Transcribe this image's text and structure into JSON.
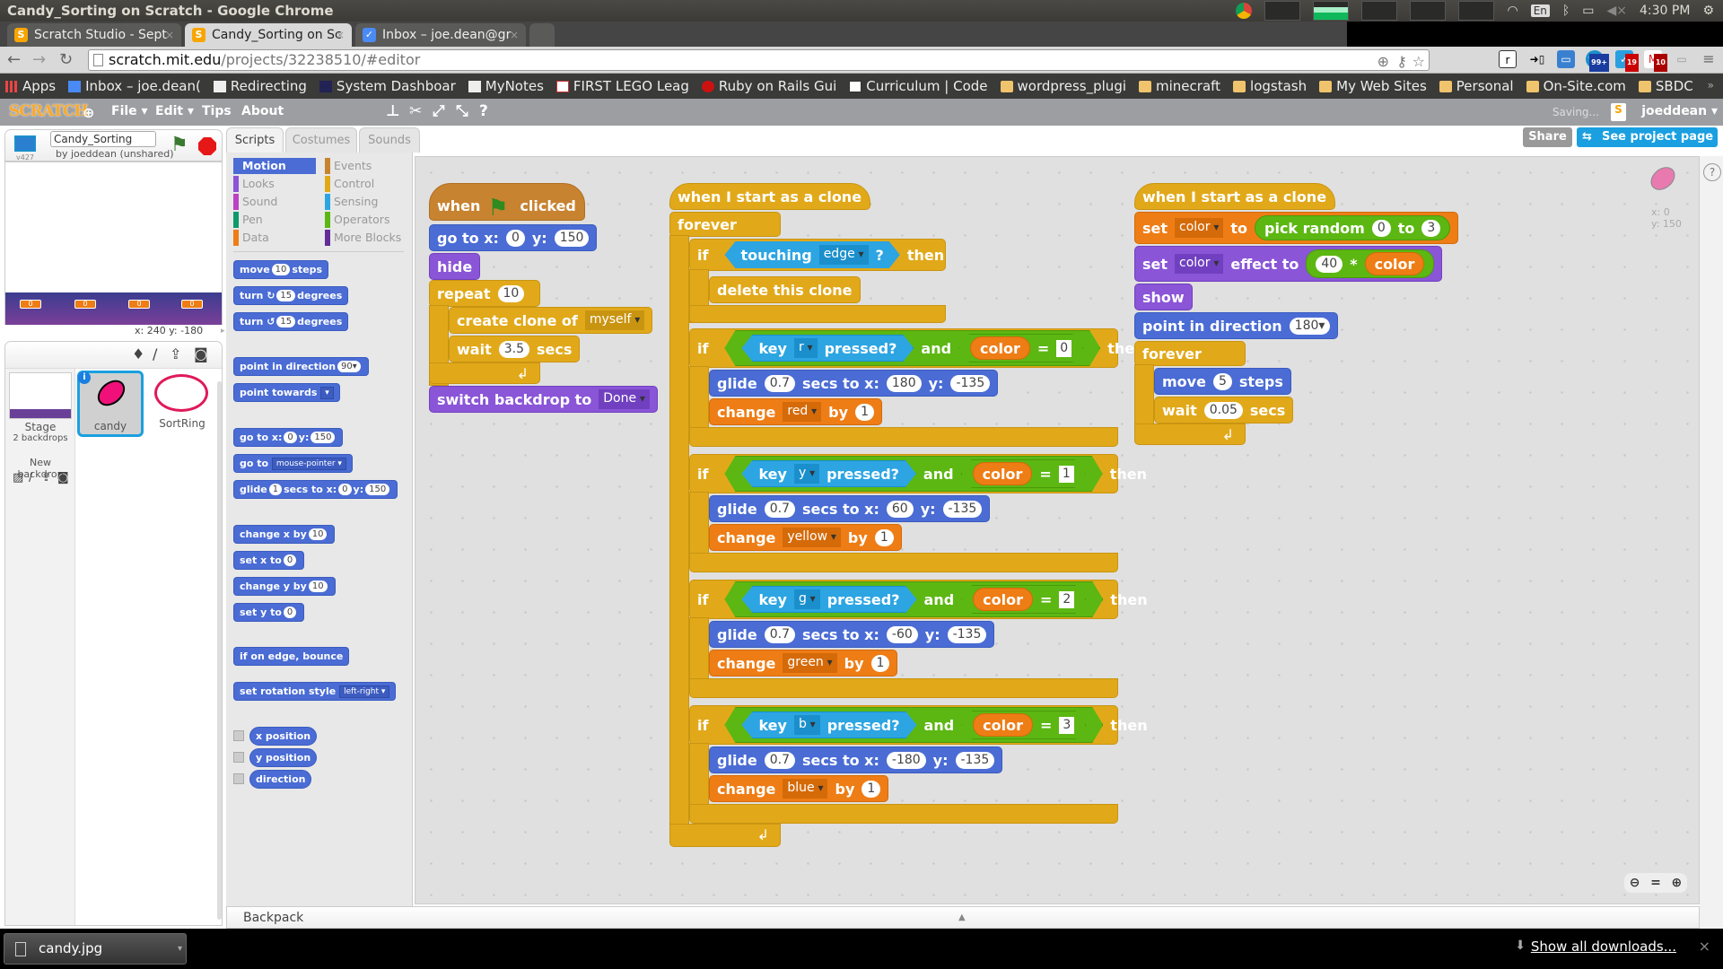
{
  "os": {
    "window_title": "Candy_Sorting on Scratch - Google Chrome",
    "tray": {
      "lang": "En",
      "time": "4:30 PM"
    }
  },
  "browser": {
    "tabs": [
      {
        "label": "Scratch Studio - Sept",
        "active": false
      },
      {
        "label": "Candy_Sorting on Sc",
        "active": true
      },
      {
        "label": "Inbox – joe.dean@gr",
        "active": false
      }
    ],
    "url_host": "scratch.mit.edu",
    "url_path": "/projects/32238510/#editor",
    "extensions": [
      {
        "name": "r-icon"
      },
      {
        "name": "phone-icon"
      },
      {
        "name": "window-icon"
      },
      {
        "name": "skype-icon",
        "badge": "99+"
      },
      {
        "name": "tasks-icon",
        "badge": "19"
      },
      {
        "name": "gmail-icon",
        "badge": "10"
      }
    ],
    "bookmarks": [
      {
        "label": "Apps",
        "type": "apps"
      },
      {
        "label": "Inbox – joe.dean(",
        "type": "mail"
      },
      {
        "label": "Redirecting",
        "type": "page"
      },
      {
        "label": "System Dashboar",
        "type": "page"
      },
      {
        "label": "MyNotes",
        "type": "page"
      },
      {
        "label": "FIRST LEGO Leag",
        "type": "page"
      },
      {
        "label": "Ruby on Rails Gui",
        "type": "page"
      },
      {
        "label": "Curriculum | Code",
        "type": "page"
      },
      {
        "label": "wordpress_plugi",
        "type": "folder"
      },
      {
        "label": "minecraft",
        "type": "folder"
      },
      {
        "label": "logstash",
        "type": "folder"
      },
      {
        "label": "My Web Sites",
        "type": "folder"
      },
      {
        "label": "Personal",
        "type": "folder"
      },
      {
        "label": "On-Site.com",
        "type": "folder"
      },
      {
        "label": "SBDC",
        "type": "folder"
      }
    ],
    "downloads": {
      "file": "candy.jpg",
      "show_all": "Show all downloads..."
    }
  },
  "scratch": {
    "logo": "SCRATCH",
    "menu": [
      "File ▾",
      "Edit ▾",
      "Tips",
      "About"
    ],
    "saving": "Saving...",
    "user": "joeddean ▾",
    "share": "Share",
    "see_project": "See project page",
    "project_title": "Candy_Sorting",
    "author": "by joeddean (unshared)",
    "version": "v427",
    "stage_coords": "x: 240  y: -180",
    "monitors": [
      "0",
      "0",
      "0",
      "0"
    ],
    "sprites": [
      {
        "name": "candy",
        "selected": true
      },
      {
        "name": "SortRing",
        "selected": false
      }
    ],
    "stage": {
      "label": "Stage",
      "backdrops": "2 backdrops",
      "new_backdrop": "New backdrop"
    },
    "editor_tabs": [
      "Scripts",
      "Costumes",
      "Sounds"
    ],
    "categories": [
      {
        "label": "Motion",
        "color": "#4a6cd4",
        "selected": true
      },
      {
        "label": "Events",
        "color": "#c88330"
      },
      {
        "label": "Looks",
        "color": "#8a55d7"
      },
      {
        "label": "Control",
        "color": "#e1a91a"
      },
      {
        "label": "Sound",
        "color": "#bb42c3"
      },
      {
        "label": "Sensing",
        "color": "#2ca5e2"
      },
      {
        "label": "Pen",
        "color": "#0e9a6c"
      },
      {
        "label": "Operators",
        "color": "#5cb712"
      },
      {
        "label": "Data",
        "color": "#ee7d16"
      },
      {
        "label": "More Blocks",
        "color": "#632d99"
      }
    ],
    "palette": {
      "move": [
        "move",
        "10",
        "steps"
      ],
      "turn_cw": [
        "turn",
        "15",
        "degrees"
      ],
      "turn_ccw": [
        "turn",
        "15",
        "degrees"
      ],
      "point_dir": [
        "point in direction",
        "90▾"
      ],
      "point_towards": [
        "point towards"
      ],
      "goto_xy": [
        "go to x:",
        "0",
        "y:",
        "150"
      ],
      "goto": [
        "go to",
        "mouse-pointer ▾"
      ],
      "glide": [
        "glide",
        "1",
        "secs to x:",
        "0",
        "y:",
        "150"
      ],
      "change_x": [
        "change x by",
        "10"
      ],
      "set_x": [
        "set x to",
        "0"
      ],
      "change_y": [
        "change y by",
        "10"
      ],
      "set_y": [
        "set y to",
        "0"
      ],
      "bounce": "if on edge, bounce",
      "rotation": [
        "set rotation style",
        "left-right ▾"
      ],
      "reporters": [
        "x position",
        "y position",
        "direction"
      ]
    },
    "sprite_info": {
      "x": "x: 0",
      "y": "y: 150"
    },
    "backpack": "Backpack",
    "script1": {
      "hat": [
        "when",
        "clicked"
      ],
      "goto": [
        "go to x:",
        "0",
        "y:",
        "150"
      ],
      "hide": "hide",
      "repeat": [
        "repeat",
        "10"
      ],
      "clone": [
        "create clone of",
        "myself"
      ],
      "wait": [
        "wait",
        "3.5",
        "secs"
      ],
      "backdrop": [
        "switch backdrop to",
        "Done"
      ]
    },
    "script2": {
      "hat": "when I start as a clone",
      "forever": "forever",
      "if_edge": [
        "if",
        "touching",
        "edge",
        "?",
        "then"
      ],
      "delete": "delete this clone",
      "ifs": [
        {
          "key": "r",
          "value": "0",
          "x": "180",
          "y": "-135",
          "var": "red"
        },
        {
          "key": "y",
          "value": "1",
          "x": "60",
          "y": "-135",
          "var": "yellow"
        },
        {
          "key": "g",
          "value": "2",
          "x": "-60",
          "y": "-135",
          "var": "green"
        },
        {
          "key": "b",
          "value": "3",
          "x": "-180",
          "y": "-135",
          "var": "blue"
        }
      ],
      "words": {
        "if": "if",
        "key": "key",
        "pressed": "pressed?",
        "and": "and",
        "color": "color",
        "eq": "=",
        "then": "then",
        "glide": "glide",
        "secs_to_x": "secs to x:",
        "y": "y:",
        "secs": "0.7",
        "change": "change",
        "by": "by",
        "one": "1"
      }
    },
    "script3": {
      "hat": "when I start as a clone",
      "set_var": [
        "set",
        "color",
        "to",
        "pick random",
        "0",
        "to",
        "3"
      ],
      "set_effect": [
        "set",
        "color",
        "effect to",
        "40",
        "*",
        "color"
      ],
      "show": "show",
      "point": [
        "point in direction",
        "180▾"
      ],
      "forever": "forever",
      "move": [
        "move",
        "5",
        "steps"
      ],
      "wait": [
        "wait",
        "0.05",
        "secs"
      ]
    }
  }
}
